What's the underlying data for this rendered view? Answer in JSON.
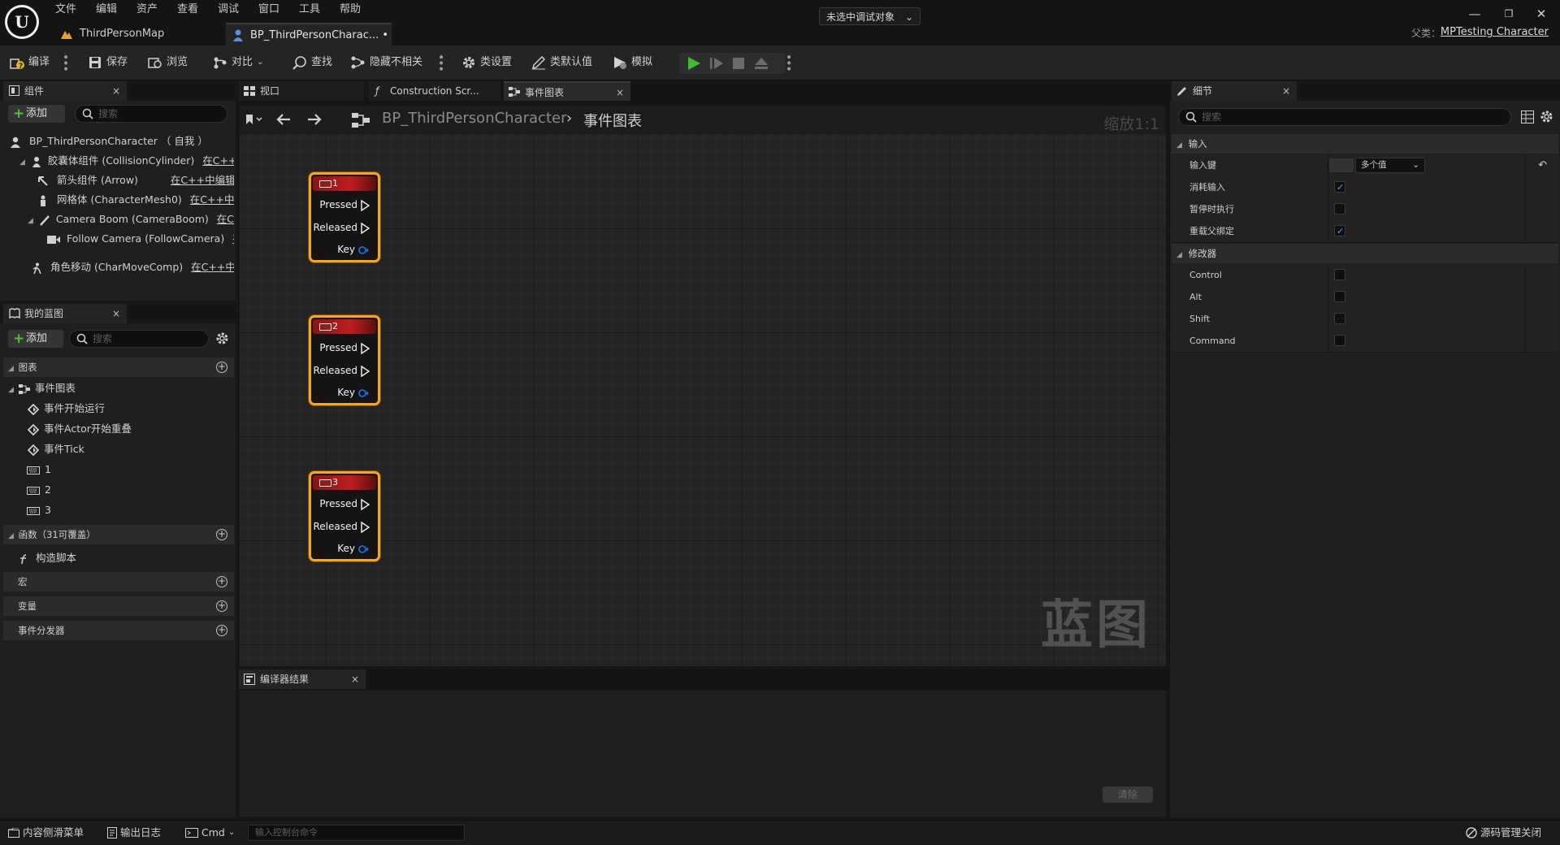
{
  "menu": [
    "文件",
    "编辑",
    "资产",
    "查看",
    "调试",
    "窗口",
    "工具",
    "帮助"
  ],
  "doc_tabs": {
    "map": "ThirdPersonMap",
    "blueprint": "BP_ThirdPersonCharac... •",
    "close": "×"
  },
  "parent": {
    "label": "父类：",
    "value": "MPTesting Character"
  },
  "window_controls": {
    "minimize": "—",
    "restore": "❐",
    "close": "✕"
  },
  "toolbar": {
    "compile": "编译",
    "save": "保存",
    "browse": "浏览",
    "diff": "对比",
    "find": "查找",
    "hide_unrelated": "隐藏不相关",
    "class_settings": "类设置",
    "class_defaults": "类默认值",
    "simulate": "模拟",
    "debug_object": "未选中调试对象"
  },
  "components": {
    "tab": "组件",
    "add": "添加",
    "search_placeholder": "搜索",
    "root": "BP_ThirdPersonCharacter （ 自我 ）",
    "items": [
      {
        "label": "胶囊体组件 (CollisionCylinder)",
        "link": "在C++中"
      },
      {
        "label": "箭头组件 (Arrow)",
        "link": "在C++中编辑"
      },
      {
        "label": "网格体 (CharacterMesh0)",
        "link": "在C++中编"
      },
      {
        "label": "Camera Boom (CameraBoom)",
        "link": "在C++"
      },
      {
        "label": "Follow Camera (FollowCamera)",
        "link": "在C"
      },
      {
        "label": "角色移动 (CharMoveComp)",
        "link": "在C++中编"
      }
    ]
  },
  "my_blueprint": {
    "tab": "我的蓝图",
    "add": "添加",
    "search_placeholder": "搜索",
    "graphs_section": "图表",
    "event_graph": "事件图表",
    "events": [
      "事件开始运行",
      "事件Actor开始重叠",
      "事件Tick"
    ],
    "keys": [
      "1",
      "2",
      "3"
    ],
    "functions_section": "函数（31可覆盖）",
    "construction_script": "构造脚本",
    "macros_section": "宏",
    "variables_section": "变量",
    "dispatchers_section": "事件分发器"
  },
  "editor_tabs": {
    "viewport": "视口",
    "construction": "Construction Scr...",
    "event_graph": "事件图表"
  },
  "graph": {
    "breadcrumb_root": "BP_ThirdPersonCharacter",
    "breadcrumb_current": "事件图表",
    "zoom": "缩放1:1",
    "watermark": "蓝图",
    "nodes": [
      {
        "title": "1",
        "pressed": "Pressed",
        "released": "Released",
        "key": "Key"
      },
      {
        "title": "2",
        "pressed": "Pressed",
        "released": "Released",
        "key": "Key"
      },
      {
        "title": "3",
        "pressed": "Pressed",
        "released": "Released",
        "key": "Key"
      }
    ]
  },
  "compiler": {
    "tab": "编译器结果",
    "clear": "清除"
  },
  "details": {
    "tab": "细节",
    "search_placeholder": "搜索",
    "input_section": "输入",
    "input_key_label": "输入键",
    "input_key_value": "多个值",
    "rows_input": [
      {
        "label": "消耗输入",
        "checked": true
      },
      {
        "label": "暂停时执行",
        "checked": false
      },
      {
        "label": "重载父绑定",
        "checked": true
      }
    ],
    "modifier_section": "修改器",
    "rows_modifier": [
      {
        "label": "Control",
        "checked": false
      },
      {
        "label": "Alt",
        "checked": false
      },
      {
        "label": "Shift",
        "checked": false
      },
      {
        "label": "Command",
        "checked": false
      }
    ]
  },
  "statusbar": {
    "content_drawer": "内容侧滑菜单",
    "output_log": "输出日志",
    "cmd": "Cmd",
    "console_placeholder": "输入控制台命令",
    "source_control": "源码管理关闭"
  }
}
